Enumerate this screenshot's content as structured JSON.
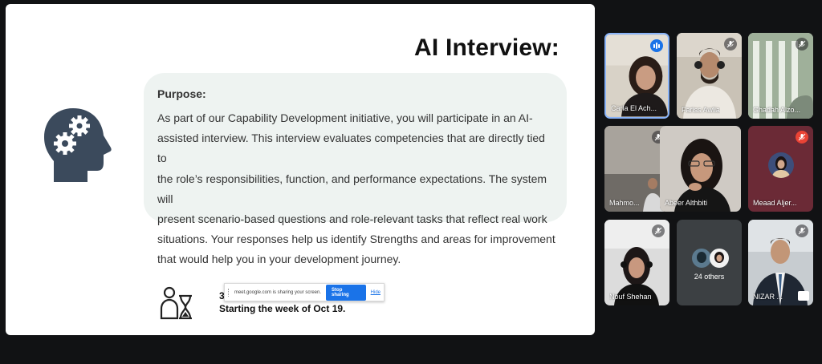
{
  "slide": {
    "title": "AI Interview:",
    "purpose_label": "Purpose:",
    "purpose_lines": [
      "As part of our Capability Development initiative, you will participate in an AI-",
      "assisted interview. This interview evaluates competencies that are directly tied to",
      "the role’s responsibilities, function, and performance expectations. The system will",
      "present scenario-based questions and role-relevant tasks that reflect real work",
      "situations. Your responses help us identify Strengths and areas for improvement",
      "that would help you in your development journey."
    ],
    "start_digit": "3",
    "start_text": "Starting the week of Oct 19."
  },
  "share_bar": {
    "message": "meet.google.com is sharing your screen.",
    "stop_label": "Stop sharing",
    "hide_label": "Hide"
  },
  "participants": [
    {
      "name": "Carla El Ach...",
      "status": "speaking",
      "highlighted": true
    },
    {
      "name": "Fariss Awlia",
      "status": "muted"
    },
    {
      "name": "Ghadah Alzo...",
      "status": "muted"
    },
    {
      "name": "Mahmo...",
      "status": "muted"
    },
    {
      "name": "Abeer Althbiti",
      "status": "muted"
    },
    {
      "name": "Meaad Aljer...",
      "status": "muted-red"
    },
    {
      "name": "Nouf Shehan",
      "status": "muted"
    },
    {
      "name": "24 others",
      "status": "group"
    },
    {
      "name": "NIZAR ...",
      "status": "muted"
    }
  ],
  "colors": {
    "background": "#111214",
    "active_border": "#8ab4f8",
    "meet_blue": "#1a73e8",
    "muted_red": "#ea4335",
    "icon_slate": "#3b4a5c"
  }
}
